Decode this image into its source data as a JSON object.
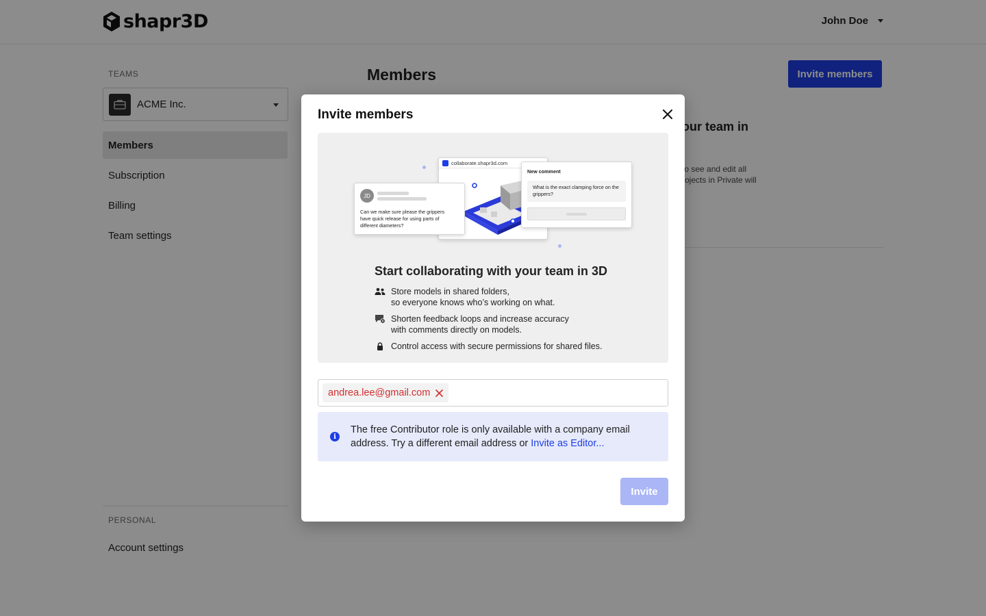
{
  "brand": {
    "logo_text": "shapr3D",
    "accent": "#1e3ee6"
  },
  "header": {
    "user_name": "John Doe"
  },
  "sidebar": {
    "teams_label": "TEAMS",
    "team_name": "ACME Inc.",
    "items": [
      {
        "label": "Members",
        "active": true
      },
      {
        "label": "Subscription",
        "active": false
      },
      {
        "label": "Billing",
        "active": false
      },
      {
        "label": "Team settings",
        "active": false
      }
    ],
    "personal_label": "PERSONAL",
    "account_settings": "Account settings"
  },
  "main": {
    "title": "Members",
    "invite_button": "Invite members",
    "bg_card_title_fragment": "our team in",
    "bg_card_text_fragment": "to see and edit all\nrojects in Private will"
  },
  "modal": {
    "title": "Invite members",
    "illustration": {
      "url": "collaborate.shapr3d.com",
      "avatar_initials": "JD",
      "comment_text": "Can we make sure please the grippers have quick release for using parts of different diameters?",
      "new_comment_label": "New comment",
      "new_comment_text": "What is the exact clamping force on the grippers?"
    },
    "heading": "Start collaborating with your team in 3D",
    "features": [
      {
        "icon": "people-icon",
        "line1": "Store models in shared folders,",
        "line2": "so everyone knows who’s working on what."
      },
      {
        "icon": "comment-icon",
        "line1": "Shorten feedback loops and increase accuracy",
        "line2": "with comments directly on models."
      },
      {
        "icon": "lock-icon",
        "line1": "Control access with secure permissions for shared files.",
        "line2": ""
      }
    ],
    "email_chip": "andrea.lee@gmail.com",
    "email_placeholder": "",
    "info_text": "The free Contributor role is only available with a company email address. Try a different email address or ",
    "info_link": "Invite as Editor...",
    "invite_button": "Invite"
  }
}
